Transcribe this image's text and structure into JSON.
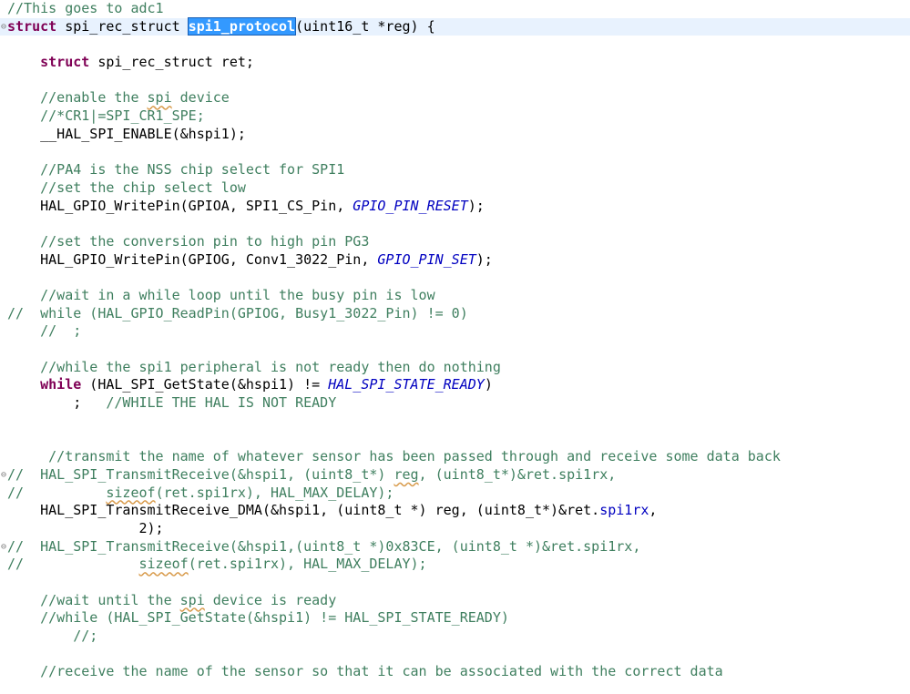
{
  "editor": {
    "lines": [
      {
        "fold": "",
        "current": false,
        "tokens": [
          [
            "comment",
            "//This goes to adc1"
          ]
        ]
      },
      {
        "fold": "⊖",
        "current": true,
        "tokens": [
          [
            "keyword",
            "struct"
          ],
          [
            "plain",
            " spi_rec_struct "
          ],
          [
            "selected",
            "spi1_protocol"
          ],
          [
            "plain",
            "(uint16_t *reg) {"
          ]
        ]
      },
      {
        "fold": "",
        "current": false,
        "tokens": []
      },
      {
        "fold": "",
        "current": false,
        "tokens": [
          [
            "plain",
            "    "
          ],
          [
            "keyword",
            "struct"
          ],
          [
            "plain",
            " spi_rec_struct ret;"
          ]
        ]
      },
      {
        "fold": "",
        "current": false,
        "tokens": []
      },
      {
        "fold": "",
        "current": false,
        "tokens": [
          [
            "plain",
            "    "
          ],
          [
            "comment",
            "//enable the "
          ],
          [
            "comment-squiggle",
            "spi"
          ],
          [
            "comment",
            " device"
          ]
        ]
      },
      {
        "fold": "",
        "current": false,
        "tokens": [
          [
            "plain",
            "    "
          ],
          [
            "comment",
            "//*CR1|=SPI_CR1_SPE;"
          ]
        ]
      },
      {
        "fold": "",
        "current": false,
        "tokens": [
          [
            "plain",
            "    __HAL_SPI_ENABLE(&hspi1);"
          ]
        ]
      },
      {
        "fold": "",
        "current": false,
        "tokens": []
      },
      {
        "fold": "",
        "current": false,
        "tokens": [
          [
            "plain",
            "    "
          ],
          [
            "comment",
            "//PA4 is the NSS chip select for SPI1"
          ]
        ]
      },
      {
        "fold": "",
        "current": false,
        "tokens": [
          [
            "plain",
            "    "
          ],
          [
            "comment",
            "//set the chip select low"
          ]
        ]
      },
      {
        "fold": "",
        "current": false,
        "tokens": [
          [
            "plain",
            "    HAL_GPIO_WritePin(GPIOA, SPI1_CS_Pin, "
          ],
          [
            "macro",
            "GPIO_PIN_RESET"
          ],
          [
            "plain",
            ");"
          ]
        ]
      },
      {
        "fold": "",
        "current": false,
        "tokens": []
      },
      {
        "fold": "",
        "current": false,
        "tokens": [
          [
            "plain",
            "    "
          ],
          [
            "comment",
            "//set the conversion pin to high pin PG3"
          ]
        ]
      },
      {
        "fold": "",
        "current": false,
        "tokens": [
          [
            "plain",
            "    HAL_GPIO_WritePin(GPIOG, Conv1_3022_Pin, "
          ],
          [
            "macro",
            "GPIO_PIN_SET"
          ],
          [
            "plain",
            ");"
          ]
        ]
      },
      {
        "fold": "",
        "current": false,
        "tokens": []
      },
      {
        "fold": "",
        "current": false,
        "tokens": [
          [
            "plain",
            "    "
          ],
          [
            "comment",
            "//wait in a while loop until the busy pin is low"
          ]
        ]
      },
      {
        "fold": "",
        "current": false,
        "tokens": [
          [
            "comment",
            "//  while (HAL_GPIO_ReadPin(GPIOG, Busy1_3022_Pin) != 0)"
          ]
        ]
      },
      {
        "fold": "",
        "current": false,
        "tokens": [
          [
            "plain",
            "    "
          ],
          [
            "comment",
            "//  ;"
          ]
        ]
      },
      {
        "fold": "",
        "current": false,
        "tokens": []
      },
      {
        "fold": "",
        "current": false,
        "tokens": [
          [
            "plain",
            "    "
          ],
          [
            "comment",
            "//while the spi1 peripheral is not ready then do nothing"
          ]
        ]
      },
      {
        "fold": "",
        "current": false,
        "tokens": [
          [
            "plain",
            "    "
          ],
          [
            "keyword",
            "while"
          ],
          [
            "plain",
            " (HAL_SPI_GetState(&hspi1) != "
          ],
          [
            "macro",
            "HAL_SPI_STATE_READY"
          ],
          [
            "plain",
            ")"
          ]
        ]
      },
      {
        "fold": "",
        "current": false,
        "tokens": [
          [
            "plain",
            "        ;   "
          ],
          [
            "comment",
            "//WHILE THE HAL IS NOT READY"
          ]
        ]
      },
      {
        "fold": "",
        "current": false,
        "tokens": []
      },
      {
        "fold": "",
        "current": false,
        "tokens": []
      },
      {
        "fold": "",
        "current": false,
        "tokens": [
          [
            "plain",
            "     "
          ],
          [
            "comment",
            "//transmit the name of whatever sensor has been passed through and receive some data back"
          ]
        ]
      },
      {
        "fold": "⊖",
        "current": false,
        "tokens": [
          [
            "comment",
            "//  HAL_SPI_TransmitReceive(&hspi1, (uint8_t*) "
          ],
          [
            "comment-squiggle",
            "reg"
          ],
          [
            "comment",
            ", (uint8_t*)&ret.spi1rx,"
          ]
        ]
      },
      {
        "fold": "",
        "current": false,
        "tokens": [
          [
            "comment",
            "//          "
          ],
          [
            "comment-squiggle",
            "sizeof"
          ],
          [
            "comment",
            "(ret.spi1rx), HAL_MAX_DELAY);"
          ]
        ]
      },
      {
        "fold": "",
        "current": false,
        "tokens": [
          [
            "plain",
            "    HAL_SPI_TransmitReceive_DMA(&hspi1, (uint8_t *) reg, (uint8_t*)&ret."
          ],
          [
            "field",
            "spi1rx"
          ],
          [
            "plain",
            ","
          ]
        ]
      },
      {
        "fold": "",
        "current": false,
        "tokens": [
          [
            "plain",
            "                2);"
          ]
        ]
      },
      {
        "fold": "⊖",
        "current": false,
        "tokens": [
          [
            "comment",
            "//  HAL_SPI_TransmitReceive(&hspi1,(uint8_t *)0x83CE, (uint8_t *)&ret.spi1rx,"
          ]
        ]
      },
      {
        "fold": "",
        "current": false,
        "tokens": [
          [
            "comment",
            "//              "
          ],
          [
            "comment-squiggle",
            "sizeof"
          ],
          [
            "comment",
            "(ret.spi1rx), HAL_MAX_DELAY);"
          ]
        ]
      },
      {
        "fold": "",
        "current": false,
        "tokens": []
      },
      {
        "fold": "",
        "current": false,
        "tokens": [
          [
            "plain",
            "    "
          ],
          [
            "comment",
            "//wait until the "
          ],
          [
            "comment-squiggle",
            "spi"
          ],
          [
            "comment",
            " device is ready"
          ]
        ]
      },
      {
        "fold": "",
        "current": false,
        "tokens": [
          [
            "plain",
            "    "
          ],
          [
            "comment",
            "//while (HAL_SPI_GetState(&hspi1) != HAL_SPI_STATE_READY)"
          ]
        ]
      },
      {
        "fold": "",
        "current": false,
        "tokens": [
          [
            "plain",
            "        "
          ],
          [
            "comment",
            "//;"
          ]
        ]
      },
      {
        "fold": "",
        "current": false,
        "tokens": []
      },
      {
        "fold": "",
        "current": false,
        "tokens": [
          [
            "plain",
            "    "
          ],
          [
            "comment",
            "//receive the name of the sensor so that it can be associated with the correct data"
          ]
        ]
      }
    ]
  },
  "colors": {
    "comment": "#3f7f5f",
    "keyword": "#7f0055",
    "macro": "#0000c0",
    "selection": "#3399ff",
    "current_line": "#e8f2fe"
  }
}
